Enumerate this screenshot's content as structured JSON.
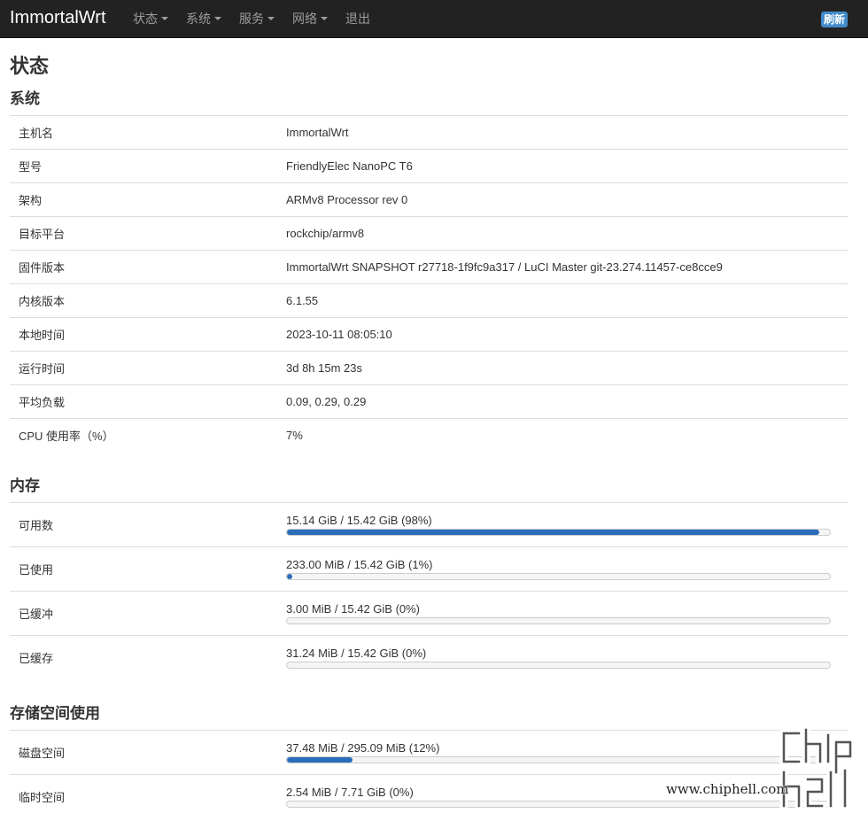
{
  "header": {
    "brand": "ImmortalWrt",
    "menu": [
      {
        "label": "状态",
        "dropdown": true
      },
      {
        "label": "系统",
        "dropdown": true
      },
      {
        "label": "服务",
        "dropdown": true
      },
      {
        "label": "网络",
        "dropdown": true
      },
      {
        "label": "退出",
        "dropdown": false
      }
    ],
    "refresh_label": "刷新"
  },
  "page_title": "状态",
  "system": {
    "title": "系统",
    "rows": [
      {
        "key": "主机名",
        "value": "ImmortalWrt"
      },
      {
        "key": "型号",
        "value": "FriendlyElec NanoPC T6"
      },
      {
        "key": "架构",
        "value": "ARMv8 Processor rev 0"
      },
      {
        "key": "目标平台",
        "value": "rockchip/armv8"
      },
      {
        "key": "固件版本",
        "value": "ImmortalWrt SNAPSHOT r27718-1f9fc9a317 / LuCI Master git-23.274.11457-ce8cce9"
      },
      {
        "key": "内核版本",
        "value": "6.1.55"
      },
      {
        "key": "本地时间",
        "value": "2023-10-11 08:05:10"
      },
      {
        "key": "运行时间",
        "value": "3d 8h 15m 23s"
      },
      {
        "key": "平均负载",
        "value": "0.09, 0.29, 0.29"
      },
      {
        "key": "CPU 使用率（%）",
        "value": "7%"
      }
    ]
  },
  "memory": {
    "title": "内存",
    "rows": [
      {
        "key": "可用数",
        "label": "15.14 GiB / 15.42 GiB (98%)",
        "percent": 98
      },
      {
        "key": "已使用",
        "label": "233.00 MiB / 15.42 GiB (1%)",
        "percent": 1
      },
      {
        "key": "已缓冲",
        "label": "3.00 MiB / 15.42 GiB (0%)",
        "percent": 0
      },
      {
        "key": "已缓存",
        "label": "31.24 MiB / 15.42 GiB (0%)",
        "percent": 0
      }
    ]
  },
  "storage": {
    "title": "存储空间使用",
    "rows": [
      {
        "key": "磁盘空间",
        "label": "37.48 MiB / 295.09 MiB (12%)",
        "percent": 12
      },
      {
        "key": "临时空间",
        "label": "2.54 MiB / 7.71 GiB (0%)",
        "percent": 0
      }
    ]
  },
  "watermark": {
    "text": "www.chiphell.com"
  },
  "colors": {
    "topbar": "#222222",
    "accent": "#428bca",
    "bar_fill": "#2a6ebb"
  }
}
